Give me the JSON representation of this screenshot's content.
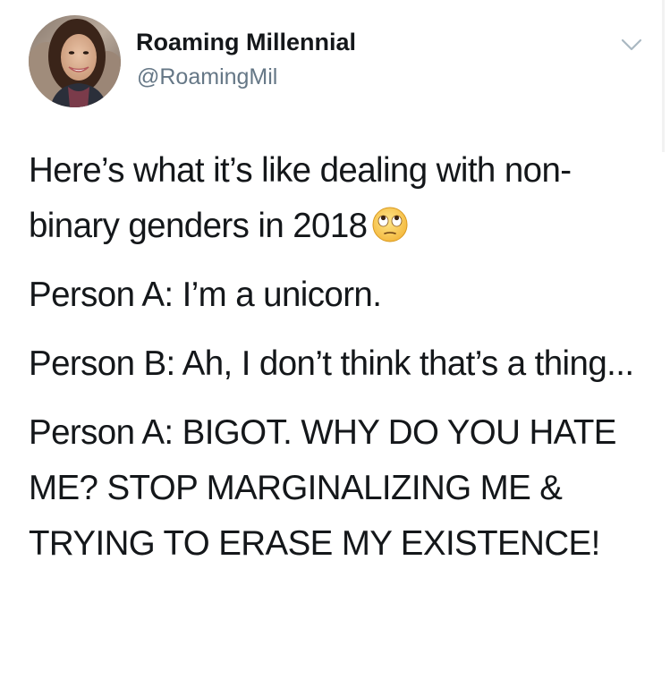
{
  "author": {
    "display_name": "Roaming Millennial",
    "handle": "@RoamingMil"
  },
  "icons": {
    "avatar": "profile-photo",
    "menu": "chevron-down-icon",
    "emoji": "face-with-rolling-eyes-icon"
  },
  "tweet": {
    "paragraphs": [
      "Here’s what it’s like dealing with non-binary genders in 2018",
      "Person A: I’m a unicorn.",
      "Person B: Ah, I don’t think that’s a thing...",
      "Person A: BIGOT. WHY DO YOU HATE ME? STOP MARGINALIZING ME & TRYING TO ERASE MY EXISTENCE!"
    ]
  },
  "colors": {
    "text": "#14171a",
    "secondary": "#657786",
    "caret": "#aab8c2"
  }
}
